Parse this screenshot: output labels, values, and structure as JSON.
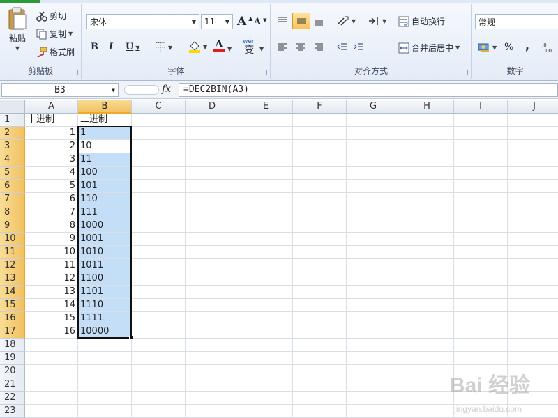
{
  "ribbon": {
    "clipboard": {
      "label": "剪贴板",
      "paste": "粘贴",
      "cut": "剪切",
      "copy": "复制",
      "format_painter": "格式刷"
    },
    "font": {
      "label": "字体",
      "name": "宋体",
      "size": "11",
      "bold": "B",
      "italic": "I",
      "underline": "U",
      "grow": "A",
      "shrink": "A",
      "font_color_letter": "A",
      "font_color": "#e02020",
      "fill_color": "#ffd800",
      "wen": "wén",
      "wen_char": "变"
    },
    "alignment": {
      "label": "对齐方式",
      "wrap": "自动换行",
      "merge": "合并后居中"
    },
    "number": {
      "label": "数字",
      "format": "常规",
      "percent": "%",
      "comma": ","
    }
  },
  "formula_bar": {
    "name_box": "B3",
    "fx": "fx",
    "formula": "=DEC2BIN(A3)"
  },
  "sheet": {
    "columns": [
      "A",
      "B",
      "C",
      "D",
      "E",
      "F",
      "G",
      "H",
      "I",
      "J"
    ],
    "rows": [
      "1",
      "2",
      "3",
      "4",
      "5",
      "6",
      "7",
      "8",
      "9",
      "10",
      "11",
      "12",
      "13",
      "14",
      "15",
      "16",
      "17",
      "18",
      "19",
      "20",
      "21",
      "22",
      "23"
    ],
    "header_a": "十进制",
    "header_b": "二进制",
    "col_a": [
      "1",
      "2",
      "3",
      "4",
      "5",
      "6",
      "7",
      "8",
      "9",
      "10",
      "11",
      "12",
      "13",
      "14",
      "15",
      "16"
    ],
    "col_b": [
      "1",
      "10",
      "11",
      "100",
      "101",
      "110",
      "111",
      "1000",
      "1001",
      "1010",
      "1011",
      "1100",
      "1101",
      "1110",
      "1111",
      "10000"
    ]
  },
  "watermark": {
    "logo": "Bai 经验",
    "url": "jingyan.baidu.com"
  }
}
